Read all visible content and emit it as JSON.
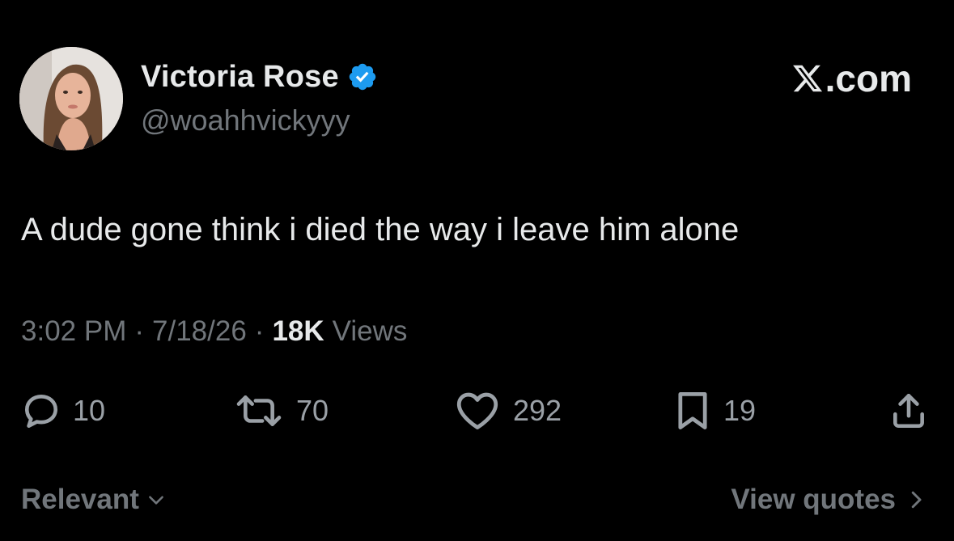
{
  "author": {
    "display_name": "Victoria Rose",
    "handle": "@woahhvickyyy",
    "verified": true,
    "avatar_icon": "profile-photo",
    "verified_color": "#1d9bf0"
  },
  "brand": {
    "text": ".com",
    "logo_icon": "x-logo"
  },
  "tweet": {
    "text": "A dude gone think i died the way i leave him alone",
    "time": "3:02 PM",
    "separator": "·",
    "date": "7/18/26",
    "views_count": "18K",
    "views_label": "Views"
  },
  "actions": {
    "reply": {
      "icon": "reply-icon",
      "count": "10"
    },
    "repost": {
      "icon": "repost-icon",
      "count": "70"
    },
    "like": {
      "icon": "heart-icon",
      "count": "292"
    },
    "bookmark": {
      "icon": "bookmark-icon",
      "count": "19"
    },
    "share": {
      "icon": "share-icon"
    }
  },
  "footer": {
    "sort_label": "Relevant",
    "view_quotes_label": "View quotes"
  },
  "colors": {
    "background": "#000000",
    "primary_text": "#e7e9ea",
    "secondary_text": "#71767b"
  }
}
